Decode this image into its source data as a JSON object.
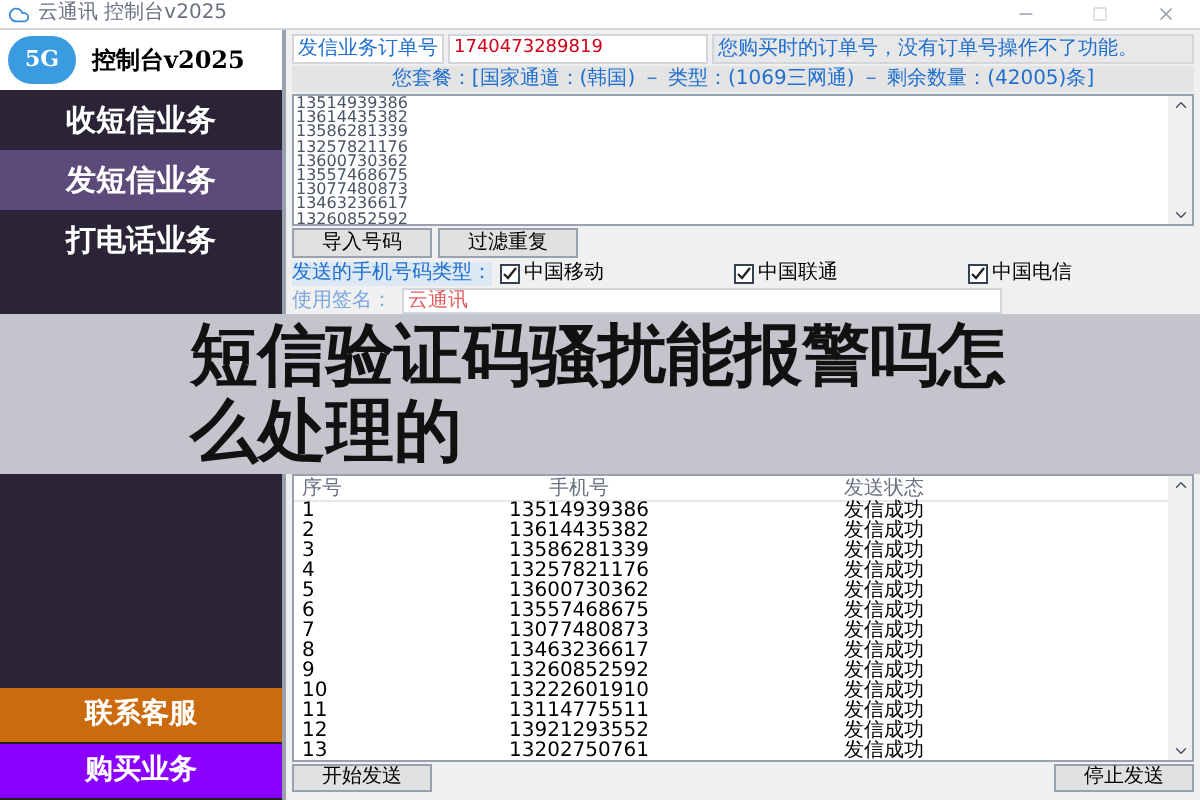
{
  "window": {
    "title": "云通讯 控制台v2025"
  },
  "sidebar": {
    "logo_badge": "5G",
    "logo_text": "控制台v2025",
    "items": [
      {
        "label": "收短信业务",
        "selected": false
      },
      {
        "label": "发短信业务",
        "selected": true
      },
      {
        "label": "打电话业务",
        "selected": false
      }
    ],
    "bottom_buttons": [
      {
        "label": "联系客服",
        "color": "#cc6a0e"
      },
      {
        "label": "购买业务",
        "color": "#8a00ff"
      }
    ]
  },
  "order": {
    "label": "发信业务订单号",
    "value": "1740473289819",
    "hint": "您购买时的订单号，没有订单号操作不了功能。"
  },
  "package_info": "您套餐：[国家通道：(韩国) － 类型：(1069三网通) － 剩余数量：(42005)条]",
  "numbers": [
    "13514939386",
    "13614435382",
    "13586281339",
    "13257821176",
    "13600730362",
    "13557468675",
    "13077480873",
    "13463236617",
    "13260852592"
  ],
  "number_buttons": [
    "导入号码",
    "过滤重复"
  ],
  "carrier_type": {
    "label": "发送的手机号码类型：",
    "options": [
      {
        "label": "中国移动",
        "checked": true
      },
      {
        "label": "中国联通",
        "checked": true
      },
      {
        "label": "中国电信",
        "checked": true
      }
    ]
  },
  "signature": {
    "label": "使用签名：",
    "value": "云通讯"
  },
  "overlay_title": [
    "短信验证码骚扰能报警吗怎",
    "么处理的"
  ],
  "table": {
    "columns": [
      "序号",
      "手机号",
      "发送状态"
    ],
    "rows": [
      [
        "1",
        "13514939386",
        "发信成功"
      ],
      [
        "2",
        "13614435382",
        "发信成功"
      ],
      [
        "3",
        "13586281339",
        "发信成功"
      ],
      [
        "4",
        "13257821176",
        "发信成功"
      ],
      [
        "5",
        "13600730362",
        "发信成功"
      ],
      [
        "6",
        "13557468675",
        "发信成功"
      ],
      [
        "7",
        "13077480873",
        "发信成功"
      ],
      [
        "8",
        "13463236617",
        "发信成功"
      ],
      [
        "9",
        "13260852592",
        "发信成功"
      ],
      [
        "10",
        "13222601910",
        "发信成功"
      ],
      [
        "11",
        "13114775511",
        "发信成功"
      ],
      [
        "12",
        "13921293552",
        "发信成功"
      ],
      [
        "13",
        "13202750761",
        "发信成功"
      ]
    ]
  },
  "actions": [
    "开始发送",
    "停止发送"
  ]
}
